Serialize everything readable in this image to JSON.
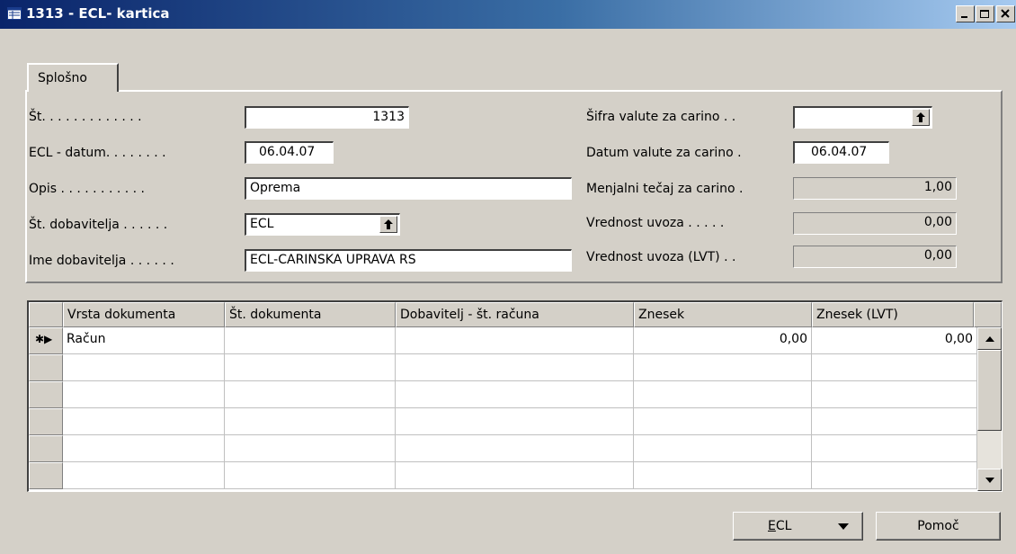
{
  "window": {
    "title": "1313 - ECL- kartica",
    "controls": [
      "minimize",
      "maximize",
      "close"
    ]
  },
  "tab": {
    "label": "Splošno"
  },
  "left_fields": {
    "st": {
      "label": "Št. . . . . . . . . . . . .",
      "value": "1313"
    },
    "datum": {
      "label": "ECL - datum. . . . . . . .",
      "value": "06.04.07"
    },
    "opis": {
      "label": "Opis . . . . . . . . . . .",
      "value": "Oprema"
    },
    "st_dobavitelja": {
      "label": "Št. dobavitelja . . . . . .",
      "value": "ECL"
    },
    "ime_dobavitelja": {
      "label": "Ime dobavitelja . . . . . .",
      "value": "ECL-CARINSKA UPRAVA RS"
    }
  },
  "right_fields": {
    "sifra_valute": {
      "label": "Šifra valute za carino . .",
      "value": ""
    },
    "datum_valute": {
      "label": "Datum valute za carino .",
      "value": "06.04.07"
    },
    "menjalni_tecaj": {
      "label": "Menjalni tečaj za carino .",
      "value": "1,00"
    },
    "vrednost_uvoza": {
      "label": "Vrednost uvoza . . . . .",
      "value": "0,00"
    },
    "vrednost_uvoza_lvt": {
      "label": "Vrednost uvoza (LVT) . .",
      "value": "0,00"
    }
  },
  "grid": {
    "columns": [
      "Vrsta dokumenta",
      "Št. dokumenta",
      "Dobavitelj - št. računa",
      "Znesek",
      "Znesek (LVT)"
    ],
    "rows": [
      {
        "marker": "✱▶",
        "cells": [
          "Račun",
          "",
          "",
          "0,00",
          "0,00"
        ]
      },
      {
        "marker": "",
        "cells": [
          "",
          "",
          "",
          "",
          ""
        ]
      },
      {
        "marker": "",
        "cells": [
          "",
          "",
          "",
          "",
          ""
        ]
      },
      {
        "marker": "",
        "cells": [
          "",
          "",
          "",
          "",
          ""
        ]
      },
      {
        "marker": "",
        "cells": [
          "",
          "",
          "",
          "",
          ""
        ]
      },
      {
        "marker": "",
        "cells": [
          "",
          "",
          "",
          "",
          ""
        ]
      }
    ]
  },
  "buttons": {
    "ecl": {
      "label": "ECL",
      "mnemonic": "E"
    },
    "help": {
      "label": "Pomoč"
    }
  },
  "icons": {
    "window": "form-icon",
    "lookup": "lookup-arrow-icon",
    "dropdown": "dropdown-arrow-icon"
  }
}
